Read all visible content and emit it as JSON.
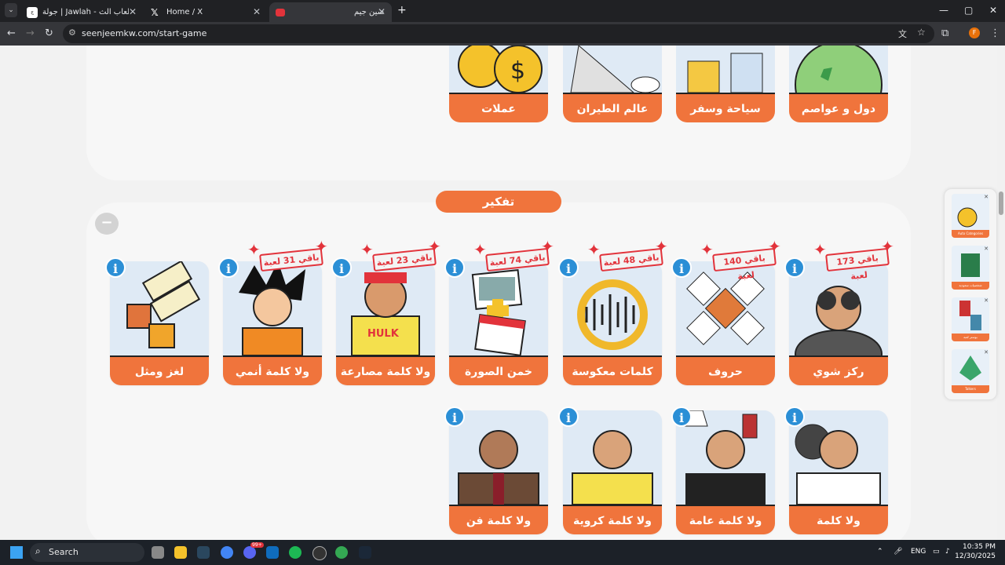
{
  "browser": {
    "tabs": [
      {
        "title": "جولة | Jawlah - منصة الألعاب الث...",
        "close": "✕"
      },
      {
        "title": "Home / X",
        "close": "✕"
      },
      {
        "title": "سين جيم",
        "close": "✕"
      }
    ],
    "new_tab": "+",
    "url": "seenjeemkw.com/start-game",
    "profile_letter": "F",
    "window_controls": {
      "minimize": "—",
      "maximize": "▢",
      "close": "✕"
    }
  },
  "upper_categories": [
    {
      "label": "دول و عواصم"
    },
    {
      "label": "سياحة وسفر"
    },
    {
      "label": "عالم الطيران"
    },
    {
      "label": "عملات"
    }
  ],
  "section": {
    "title": "تفكير",
    "collapse": "−"
  },
  "cards_row1": [
    {
      "label": "ركز شوي",
      "badge": "باقي 173 لعبة"
    },
    {
      "label": "حروف",
      "badge": "باقي 140 لعبة"
    },
    {
      "label": "كلمات معكوسة",
      "badge": "باقي 48 لعبة"
    },
    {
      "label": "خمن الصورة",
      "badge": "باقي 74 لعبة"
    },
    {
      "label": "ولا كلمة مصارعة",
      "badge": "باقي 23 لعبة"
    },
    {
      "label": "ولا كلمة أنمي",
      "badge": "باقي 31 لعبة"
    },
    {
      "label": "لغز ومثل",
      "badge": ""
    }
  ],
  "cards_row2": [
    {
      "label": "ولا كلمة"
    },
    {
      "label": "ولا كلمة عامة"
    },
    {
      "label": "ولا كلمة كروية"
    },
    {
      "label": "ولا كلمة فن أجنبي"
    }
  ],
  "info_icon": "i",
  "side_panel": [
    {
      "label": "Auto Categories"
    },
    {
      "label": "شخصيات سعودية"
    },
    {
      "label": "بوستر لعبة"
    },
    {
      "label": "Talkers"
    }
  ],
  "taskbar": {
    "search": "Search",
    "lang": "ENG",
    "time": "10:35 PM",
    "date": "12/30/2025",
    "badge": "99+"
  },
  "colors": {
    "accent": "#f0743c",
    "info": "#2b8fd6",
    "badge_red": "#e2333b",
    "card_bg": "#dfeaf5"
  }
}
